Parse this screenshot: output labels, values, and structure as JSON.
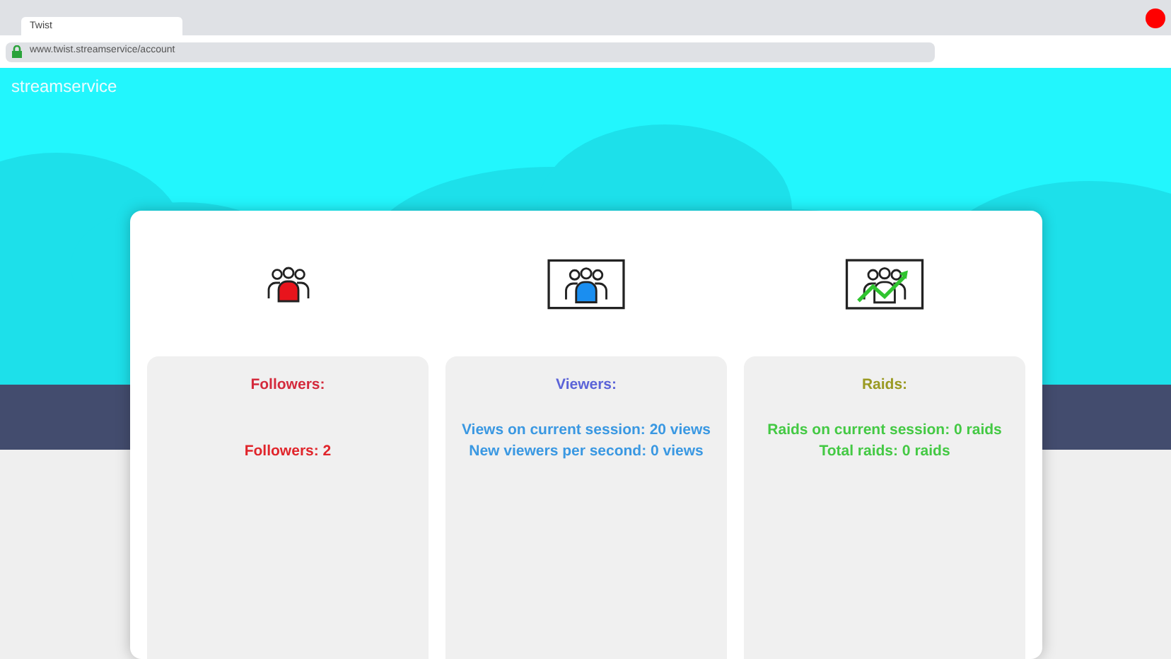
{
  "browser": {
    "tab": {
      "title": "Twist"
    },
    "address": "www.twist.streamservice/account"
  },
  "site": {
    "brand": "streamservice"
  },
  "cards": [
    {
      "kind": "followers",
      "title": "Followers:",
      "color": "#d42a3c",
      "lines": [
        {
          "text": "Followers: 2",
          "color": "#e0252b"
        }
      ]
    },
    {
      "kind": "viewers",
      "title": "Viewers:",
      "color": "#5b63d8",
      "lines": [
        {
          "text": "Views on current session: 20 views",
          "color": "#3a98e2"
        },
        {
          "text": "New viewers per second: 0 views",
          "color": "#3a98e2"
        }
      ]
    },
    {
      "kind": "raids",
      "title": "Raids:",
      "color": "#9a9a22",
      "lines": [
        {
          "text": "Raids on current session: 0 raids",
          "color": "#44c944"
        },
        {
          "text": "Total raids: 0 raids",
          "color": "#44c944"
        }
      ]
    }
  ]
}
